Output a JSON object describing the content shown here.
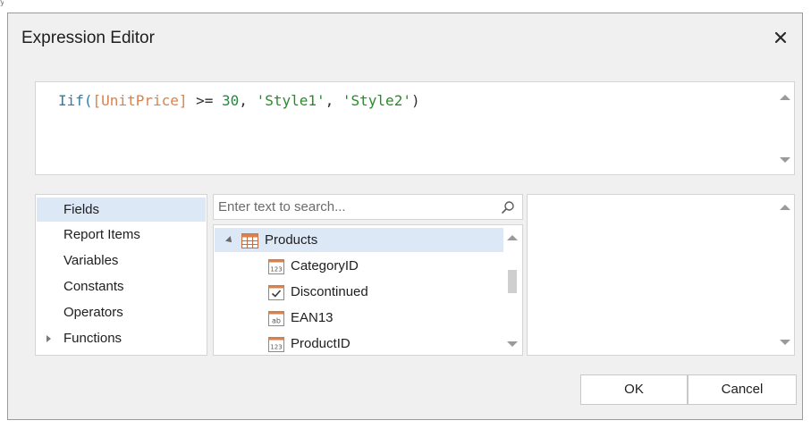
{
  "page": {
    "corner_peek": "y"
  },
  "dialog": {
    "title": "Expression Editor"
  },
  "expression": {
    "tokens": [
      {
        "text": "Iif(",
        "kind": "fn"
      },
      {
        "text": "[UnitPrice]",
        "kind": "field"
      },
      {
        "text": " >= ",
        "kind": "op"
      },
      {
        "text": "30",
        "kind": "num"
      },
      {
        "text": ", ",
        "kind": "op"
      },
      {
        "text": "'Style1'",
        "kind": "str"
      },
      {
        "text": ", ",
        "kind": "op"
      },
      {
        "text": "'Style2'",
        "kind": "str"
      },
      {
        "text": ")",
        "kind": "op"
      }
    ]
  },
  "categories": {
    "items": [
      {
        "label": "Fields",
        "selected": true
      },
      {
        "label": "Report Items"
      },
      {
        "label": "Variables"
      },
      {
        "label": "Constants"
      },
      {
        "label": "Operators"
      },
      {
        "label": "Functions",
        "expandable": true
      }
    ]
  },
  "search": {
    "placeholder": "Enter text to search..."
  },
  "tree": {
    "root": {
      "label": "Products",
      "icon": "table-icon",
      "expanded": true
    },
    "children": [
      {
        "label": "CategoryID",
        "icon": "numeric-field-icon"
      },
      {
        "label": "Discontinued",
        "icon": "boolean-field-icon"
      },
      {
        "label": "EAN13",
        "icon": "string-field-icon"
      },
      {
        "label": "ProductID",
        "icon": "numeric-field-icon"
      }
    ],
    "type_badges": {
      "numeric": "123",
      "string": "ab"
    }
  },
  "buttons": {
    "ok": "OK",
    "cancel": "Cancel"
  },
  "colors": {
    "accent": "#d9824c",
    "selection": "#dde8f6",
    "function": "#2e7ea8",
    "literal": "#1f8b3d"
  }
}
